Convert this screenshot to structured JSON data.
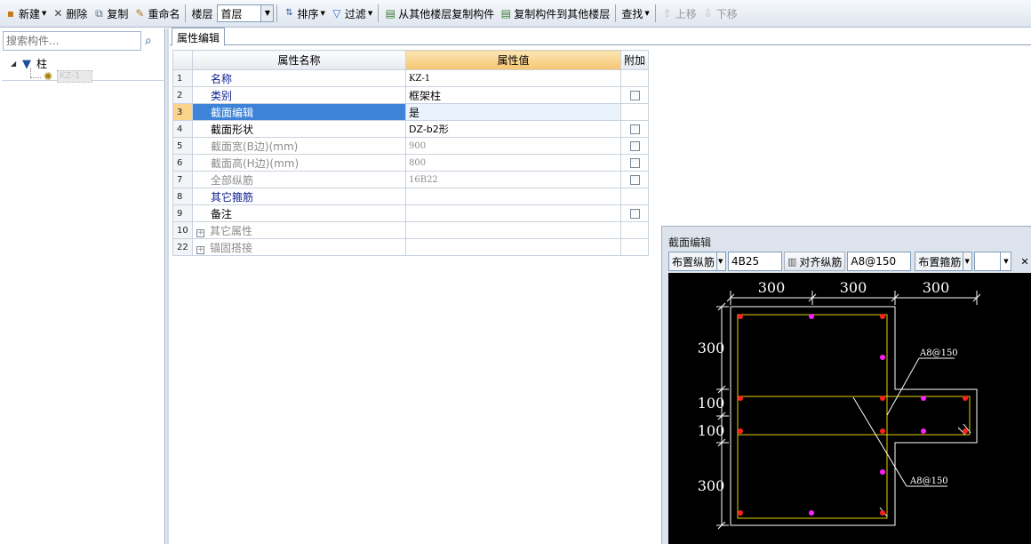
{
  "toolbar": {
    "new_label": "新建",
    "delete_label": "删除",
    "copy_label": "复制",
    "rename_label": "重命名",
    "floor_label": "楼层",
    "floor_value": "首层",
    "sort_label": "排序",
    "filter_label": "过滤",
    "copy_from_floor_label": "从其他楼层复制构件",
    "copy_to_floor_label": "复制构件到其他楼层",
    "find_label": "查找",
    "move_up_label": "上移",
    "move_down_label": "下移"
  },
  "left_panel": {
    "search_placeholder": "搜索构件...",
    "tree_root_label": "柱",
    "tree_child_label": "KZ-1"
  },
  "property_editor": {
    "tab_label": "属性编辑",
    "columns": [
      "属性名称",
      "属性值",
      "附加"
    ],
    "rows": [
      {
        "num": "1",
        "name": "名称",
        "value": "KZ-1"
      },
      {
        "num": "2",
        "name": "类别",
        "value": "框架柱"
      },
      {
        "num": "3",
        "name": "截面编辑",
        "value": "是"
      },
      {
        "num": "4",
        "name": "截面形状",
        "value": "DZ-b2形"
      },
      {
        "num": "5",
        "name": "截面宽(B边)(mm)",
        "value": "900"
      },
      {
        "num": "6",
        "name": "截面高(H边)(mm)",
        "value": "800"
      },
      {
        "num": "7",
        "name": "全部纵筋",
        "value": "16B22"
      },
      {
        "num": "8",
        "name": "其它箍筋",
        "value": ""
      },
      {
        "num": "9",
        "name": "备注",
        "value": ""
      },
      {
        "num": "10",
        "name": "其它属性",
        "value": ""
      },
      {
        "num": "22",
        "name": "锚固搭接",
        "value": ""
      }
    ]
  },
  "section_editor": {
    "title": "截面编辑",
    "place_longitudinal_label": "布置纵筋",
    "longitudinal_value": "4B25",
    "align_longitudinal_label": "对齐纵筋",
    "stirrup_value": "A8@150",
    "place_stirrup_label": "布置箍筋",
    "stirrup_type_value": "",
    "drawing": {
      "dim_top": [
        "300",
        "300",
        "300"
      ],
      "dim_left": [
        "300",
        "100",
        "100",
        "300"
      ],
      "annotation_1": "A8@150",
      "annotation_2": "A8@150"
    }
  }
}
